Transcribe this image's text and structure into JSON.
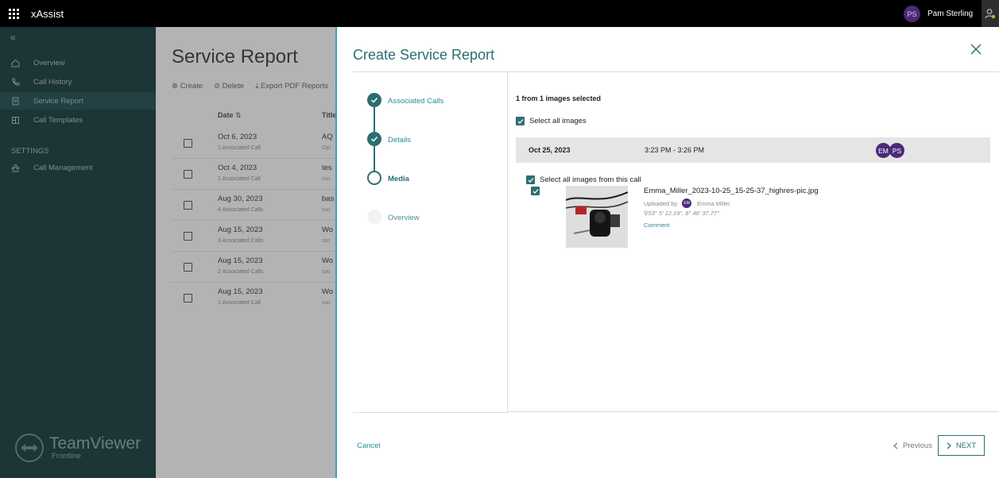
{
  "app": {
    "title": "xAssist"
  },
  "user": {
    "initials": "PS",
    "name": "Pam Sterling"
  },
  "sidebar": {
    "items": [
      {
        "label": "Overview"
      },
      {
        "label": "Call History"
      },
      {
        "label": "Service Report"
      },
      {
        "label": "Call Templates"
      }
    ],
    "settings_heading": "SETTINGS",
    "settings_items": [
      {
        "label": "Call Management"
      }
    ],
    "brand": {
      "name": "TeamViewer",
      "sub": "Frontline"
    }
  },
  "page": {
    "title": "Service Report",
    "toolbar": {
      "create": "Create",
      "delete": "Delete",
      "export": "Export PDF Reports"
    },
    "columns": {
      "date": "Date",
      "title": "Title"
    },
    "rows": [
      {
        "date": "Oct 6, 2023",
        "calls": "1 Associated Call",
        "title": "AQ",
        "sub": "Opi"
      },
      {
        "date": "Oct 4, 2023",
        "calls": "1 Associated Call",
        "title": "tes",
        "sub": "sac"
      },
      {
        "date": "Aug 30, 2023",
        "calls": "4 Associated Calls",
        "title": "bas",
        "sub": "sac"
      },
      {
        "date": "Aug 15, 2023",
        "calls": "3 Associated Calls",
        "title": "Wo",
        "sub": "sac"
      },
      {
        "date": "Aug 15, 2023",
        "calls": "2 Associated Calls",
        "title": "Wo",
        "sub": "sac"
      },
      {
        "date": "Aug 15, 2023",
        "calls": "1 Associated Call",
        "title": "Wo",
        "sub": "sac"
      }
    ]
  },
  "modal": {
    "title": "Create Service Report",
    "steps": [
      {
        "label": "Associated Calls",
        "state": "done"
      },
      {
        "label": "Details",
        "state": "done"
      },
      {
        "label": "Media",
        "state": "current"
      },
      {
        "label": "Overview",
        "state": "todo"
      }
    ],
    "media": {
      "selected_count": "1 from 1 images selected",
      "select_all_label": "Select all images",
      "call": {
        "date": "Oct 25, 2023",
        "time": "3:23 PM - 3:26 PM",
        "participants": [
          "EM",
          "PS"
        ],
        "select_all_label": "Select all images from this call"
      },
      "image": {
        "name": "Emma_Miller_2023-10-25_15-25-37_highres-pic.jpg",
        "uploaded_by_label": "Uploaded by",
        "uploader_initials": "EM",
        "uploader_name": "Emma Miller",
        "coords": "53° 5' 12.19\", 8° 46' 37.77\"",
        "comment_label": "Comment"
      }
    },
    "buttons": {
      "cancel": "Cancel",
      "previous": "Previous",
      "next": "NEXT"
    }
  },
  "colors": {
    "accent": "#2c6e72",
    "sidebar": "#254447",
    "avatar": "#4b2a78"
  }
}
